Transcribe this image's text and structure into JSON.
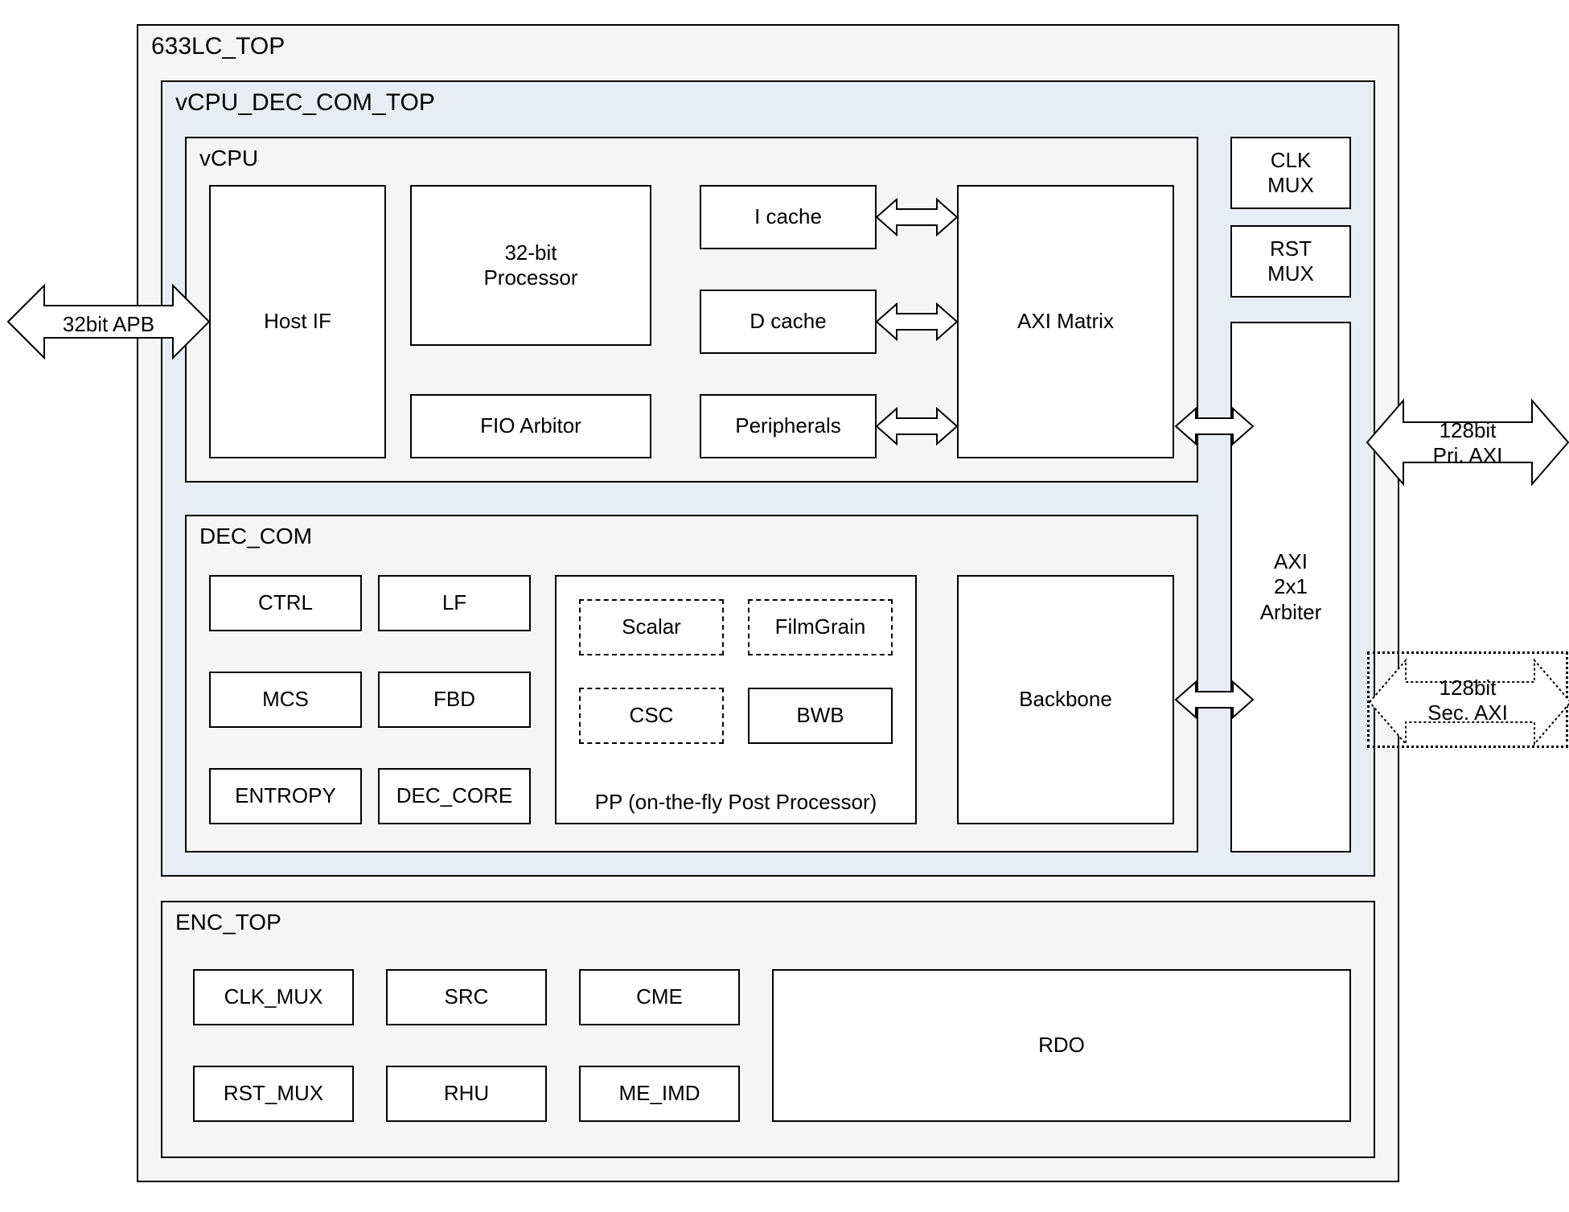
{
  "top": {
    "title": "633LC_TOP"
  },
  "vcpu_dec_com_top": {
    "title": "vCPU_DEC_COM_TOP"
  },
  "vcpu": {
    "title": "vCPU",
    "host_if": "Host IF",
    "processor": "32-bit\nProcessor",
    "fio": "FIO Arbitor",
    "icache": "I cache",
    "dcache": "D cache",
    "periph": "Peripherals",
    "axi_matrix": "AXI Matrix"
  },
  "clk_mux": "CLK\nMUX",
  "rst_mux": "RST\nMUX",
  "axi_arbiter": "AXI\n2x1\nArbiter",
  "dec_com": {
    "title": "DEC_COM",
    "ctrl": "CTRL",
    "lf": "LF",
    "mcs": "MCS",
    "fbd": "FBD",
    "entropy": "ENTROPY",
    "dec_core": "DEC_CORE",
    "pp_title": "PP (on-the-fly Post Processor)",
    "scalar": "Scalar",
    "filmgrain": "FilmGrain",
    "csc": "CSC",
    "bwb": "BWB",
    "backbone": "Backbone"
  },
  "enc_top": {
    "title": "ENC_TOP",
    "clk_mux": "CLK_MUX",
    "src": "SRC",
    "cme": "CME",
    "rst_mux": "RST_MUX",
    "rhu": "RHU",
    "me_imd": "ME_IMD",
    "rdo": "RDO"
  },
  "ext": {
    "apb": "32bit APB",
    "pri_axi": "128bit\nPri. AXI",
    "sec_axi": "128bit\nSec. AXI"
  }
}
